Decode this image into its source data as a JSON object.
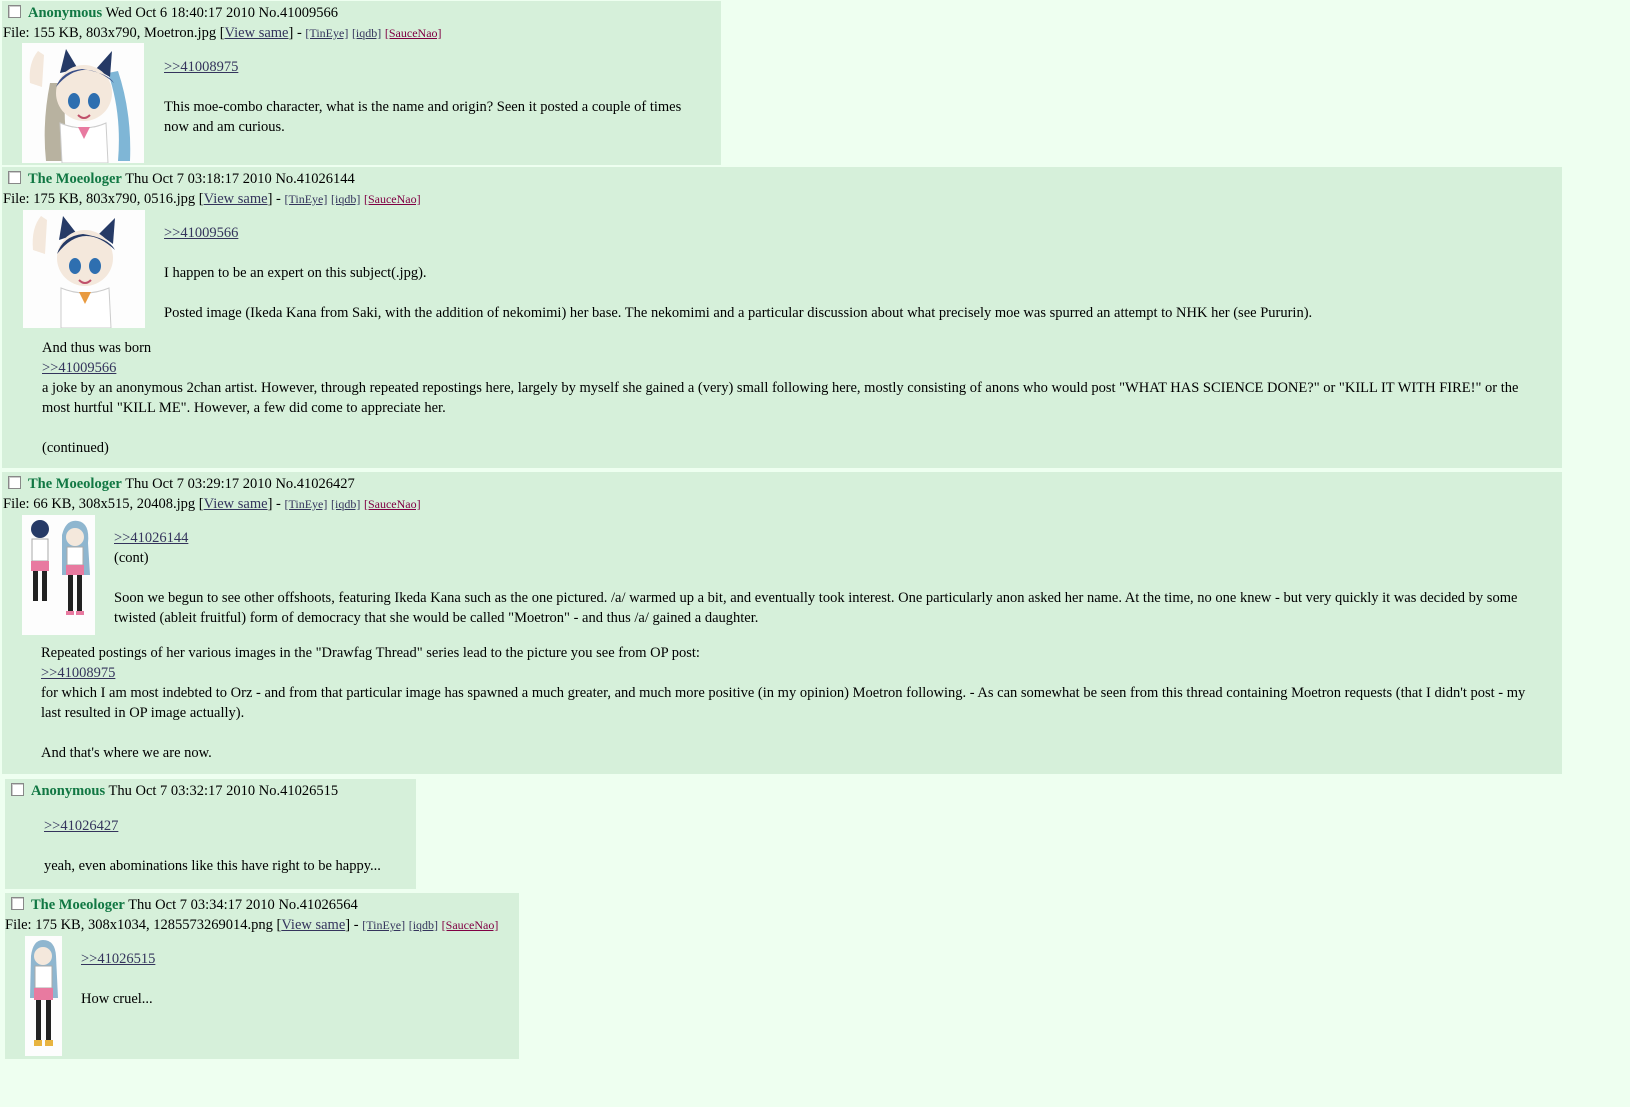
{
  "posts": [
    {
      "name": "Anonymous",
      "date": "Wed Oct 6 18:40:17 2010",
      "no": "No.41009566",
      "file": {
        "prefix": "File: 155 KB, 803x790, Moetron.jpg [",
        "view_same": "View same",
        "suffix": "] -",
        "tineye": "[TinEye]",
        "iqdb": "[iqdb]",
        "saucenao": "[SauceNao]"
      },
      "quote": ">>41008975",
      "text": "This moe-combo character, what is the name and origin? Seen it posted a couple of times now and am curious."
    },
    {
      "name": "The Moeologer",
      "date": "Thu Oct 7 03:18:17 2010",
      "no": "No.41026144",
      "file": {
        "prefix": "File: 175 KB, 803x790, 0516.jpg [",
        "view_same": "View same",
        "suffix": "] -",
        "tineye": "[TinEye]",
        "iqdb": "[iqdb]",
        "saucenao": "[SauceNao]"
      },
      "quote": ">>41009566",
      "text1": "I happen to be an expert on this subject(.jpg).",
      "text2": "Posted image (Ikeda Kana from Saki, with the addition of nekomimi) her base. The nekomimi and a particular discussion about what precisely moe was spurred an attempt to NHK her (see Pururin).",
      "text3": "And thus was born",
      "quote2": ">>41009566",
      "text4": "a joke by an anonymous 2chan artist. However, through repeated repostings here, largely by myself she gained a (very) small following here, mostly consisting of anons who would post \"WHAT HAS SCIENCE DONE?\" or \"KILL IT WITH FIRE!\" or the most hurtful \"KILL ME\". However, a few did come to appreciate her.",
      "text5": "(continued)"
    },
    {
      "name": "The Moeologer",
      "date": "Thu Oct 7 03:29:17 2010",
      "no": "No.41026427",
      "file": {
        "prefix": "File: 66 KB, 308x515, 20408.jpg [",
        "view_same": "View same",
        "suffix": "] -",
        "tineye": "[TinEye]",
        "iqdb": "[iqdb]",
        "saucenao": "[SauceNao]"
      },
      "quote": ">>41026144",
      "text1": "(cont)",
      "text2": "Soon we begun to see other offshoots, featuring Ikeda Kana such as the one pictured. /a/ warmed up a bit, and eventually took interest. One particularly anon asked her name. At the time, no one knew - but very quickly it was decided by some twisted (ableit fruitful) form of democracy that she would be called \"Moetron\" - and thus /a/ gained a daughter.",
      "text3": "Repeated postings of her various images in the \"Drawfag Thread\" series lead to the picture you see from OP post:",
      "quote2": ">>41008975",
      "text4": "for which I am most indebted to Orz - and from that particular image has spawned a much greater, and much more positive (in my opinion) Moetron following. - As can somewhat be seen from this thread containing Moetron requests (that I didn't post - my last resulted in OP image actually).",
      "text5": "And that's where we are now."
    },
    {
      "name": "Anonymous",
      "date": "Thu Oct 7 03:32:17 2010",
      "no": "No.41026515",
      "quote": ">>41026427",
      "text": "yeah, even abominations like this have right to be happy..."
    },
    {
      "name": "The Moeologer",
      "date": "Thu Oct 7 03:34:17 2010",
      "no": "No.41026564",
      "file": {
        "prefix": "File: 175 KB, 308x1034, 1285573269014.png [",
        "view_same": "View same",
        "suffix": "] -",
        "tineye": "[TinEye]",
        "iqdb": "[iqdb]",
        "saucenao": "[SauceNao]"
      },
      "quote": ">>41026515",
      "text": "How cruel..."
    }
  ]
}
